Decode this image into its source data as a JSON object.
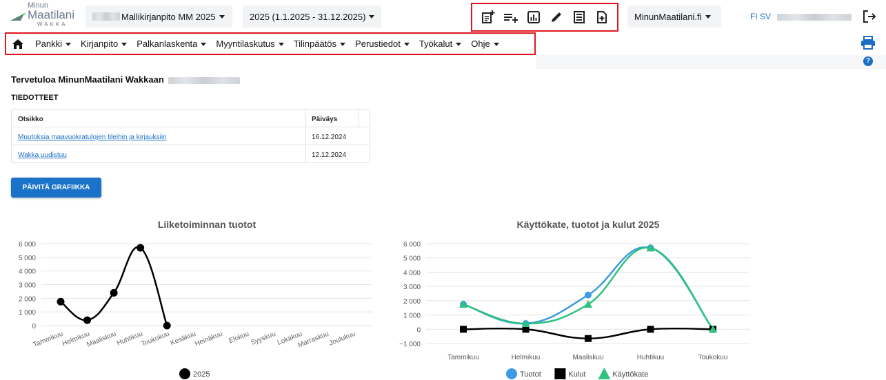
{
  "logo": {
    "line1": "Minun",
    "line2": "Maatilani",
    "line3": "WAKKA"
  },
  "company_selector": {
    "label": "Mallikirjanpito MM 2025"
  },
  "period_selector": {
    "label": "2025 (1.1.2025 - 31.12.2025)"
  },
  "toolbar_icons": [
    "add-document-icon",
    "add-list-icon",
    "bar-chart-icon",
    "pencil-icon",
    "ledger-icon",
    "new-file-icon"
  ],
  "site_selector": {
    "label": "MinunMaatilani.fi"
  },
  "language": {
    "fi": "FI",
    "sv": "SV"
  },
  "menu": {
    "items": [
      {
        "label": "Pankki"
      },
      {
        "label": "Kirjanpito"
      },
      {
        "label": "Palkanlaskenta"
      },
      {
        "label": "Myyntilaskutus"
      },
      {
        "label": "Tilinpäätös"
      },
      {
        "label": "Perustiedot"
      },
      {
        "label": "Työkalut"
      },
      {
        "label": "Ohje"
      }
    ]
  },
  "help_icon": "?",
  "welcome": {
    "text": "Tervetuloa MinunMaatilani Wakkaan"
  },
  "notices": {
    "section_title": "TIEDOTTEET",
    "columns": [
      "Otsikko",
      "Päiväys"
    ],
    "rows": [
      {
        "title": "Muutoksia maavuokratulojen tileihin ja kirjauksiin",
        "date": "16.12.2024"
      },
      {
        "title": "Wakka uudistuu",
        "date": "12.12.2024"
      }
    ]
  },
  "refresh_button": {
    "label": "PÄIVITÄ GRAFIIKKA"
  },
  "chart_data": [
    {
      "type": "line",
      "title": "Liiketoiminnan tuotot",
      "categories": [
        "Tammikuu",
        "Helmikuu",
        "Maaliskuu",
        "Huhtikuu",
        "Toukokuu",
        "Kesäkuu",
        "Heinäkuu",
        "Elokuu",
        "Syyskuu",
        "Lokakuu",
        "Marraskuu",
        "Joulukuu"
      ],
      "series": [
        {
          "name": "2025",
          "values": [
            1750,
            400,
            2400,
            5700,
            0
          ],
          "color": "#000000"
        }
      ],
      "ylim": [
        0,
        6000
      ],
      "yticks": [
        "0",
        "1 000",
        "2 000",
        "3 000",
        "4 000",
        "5 000",
        "6 000"
      ],
      "grid": true,
      "legend": "bottom"
    },
    {
      "type": "line",
      "title": "Käyttökate, tuotot ja kulut 2025",
      "categories": [
        "Tammikuu",
        "Helmikuu",
        "Maaliskuu",
        "Huhtikuu",
        "Toukokuu"
      ],
      "series": [
        {
          "name": "Tuotot",
          "values": [
            1750,
            400,
            2400,
            5700,
            0
          ],
          "color": "#3d9ae3",
          "marker": "circle"
        },
        {
          "name": "Kulut",
          "values": [
            0,
            0,
            -650,
            0,
            0
          ],
          "color": "#000000",
          "marker": "square"
        },
        {
          "name": "Käyttökate",
          "values": [
            1750,
            400,
            1750,
            5700,
            0
          ],
          "color": "#2ec27e",
          "marker": "triangle"
        }
      ],
      "ylim": [
        -1000,
        6000
      ],
      "yticks": [
        "−1 000",
        "0",
        "1 000",
        "2 000",
        "3 000",
        "4 000",
        "5 000",
        "6 000"
      ],
      "grid": true,
      "legend": "bottom"
    }
  ]
}
